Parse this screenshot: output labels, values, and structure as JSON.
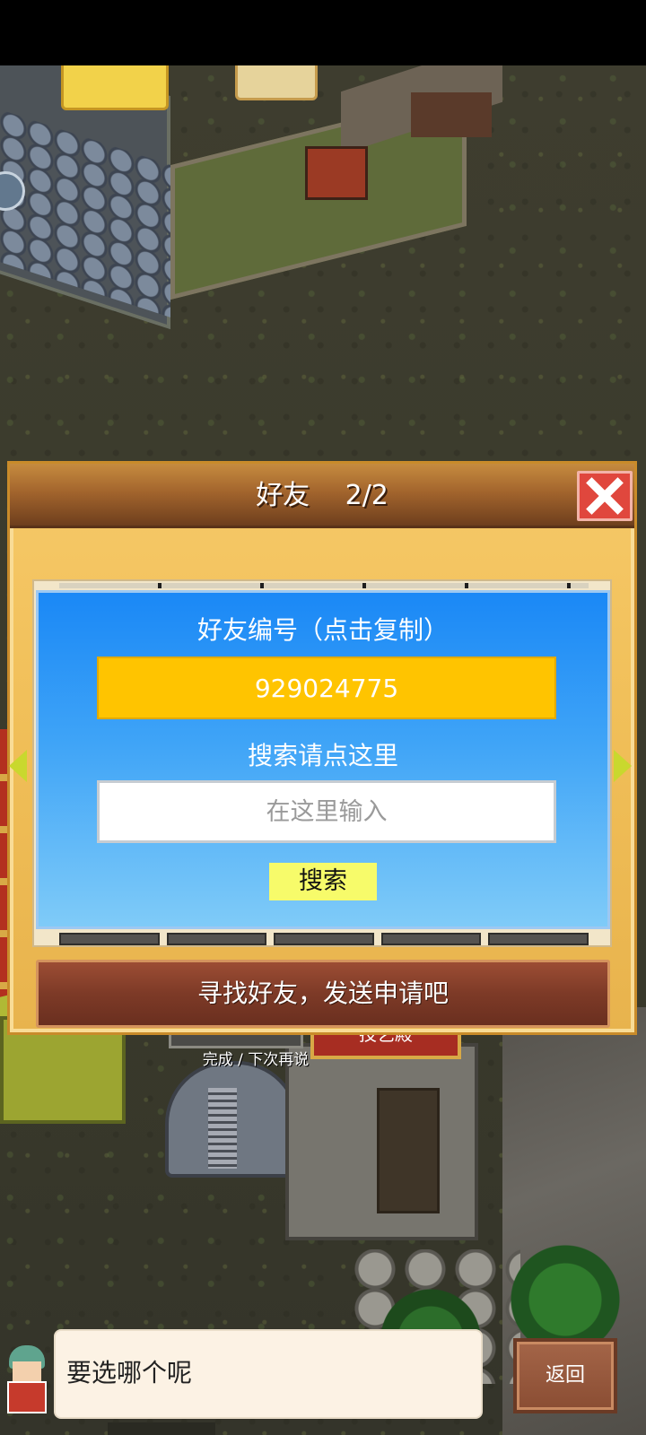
{
  "dialog": {
    "title": "好友　 2/2",
    "id_label": "好友编号（点击复制）",
    "friend_id": "929024775",
    "search_label": "搜索请点这里",
    "search_placeholder": "在这里输入",
    "search_button": "搜索",
    "find_friends_button": "寻找好友，发送申请吧"
  },
  "map": {
    "sign_text": "技艺殿",
    "done_text": "完成 / 下次再说"
  },
  "bottom": {
    "speech": "要选哪个呢",
    "back_button": "返回"
  },
  "colors": {
    "header_brown": "#a3652d",
    "card_blue": "#1a88f6",
    "id_yellow": "#ffc400",
    "search_button_yellow": "#f7fb6a",
    "close_red": "#e0473d",
    "find_button_brown": "#7d3a27"
  },
  "icons": [
    "close-icon",
    "arrow-left-icon",
    "arrow-right-icon",
    "character-avatar-icon"
  ]
}
